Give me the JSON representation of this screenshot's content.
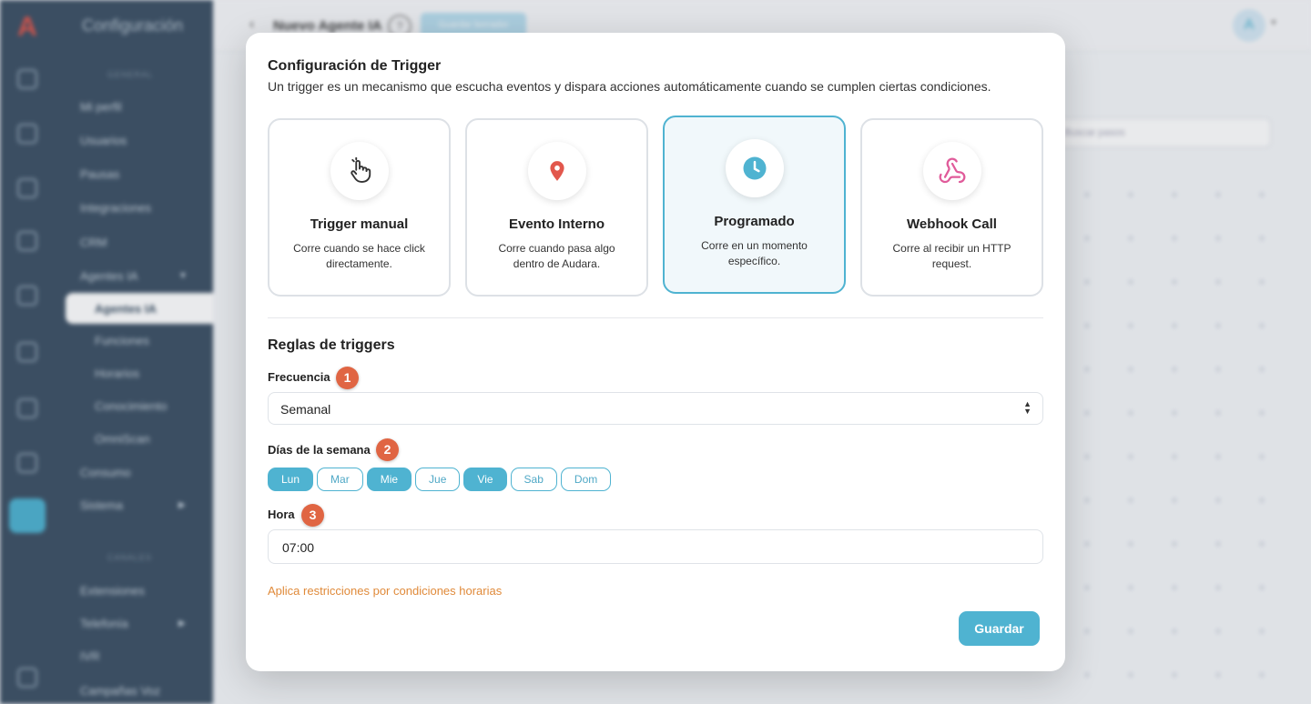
{
  "app": {
    "logo": "A",
    "menu_title": "Configuración",
    "section_general": "GENERAL",
    "section_channels": "CANALES",
    "menu_items": [
      "Mi perfil",
      "Usuarios",
      "Pausas",
      "Integraciones",
      "CRM",
      "Agentes IA",
      "Consumo",
      "Sistema",
      "Extensiones",
      "Telefonía",
      "IVR",
      "Campañas Voz"
    ],
    "submenu_selected": "Agentes IA",
    "submenu_items": [
      "Funciones",
      "Horarios",
      "Conocimiento",
      "OmniScan"
    ],
    "page_title": "Nuevo Agente IA",
    "help": "?",
    "save_draft": "Guardar borrador",
    "avatar": "A",
    "search_placeholder": "Buscar pasos"
  },
  "modal": {
    "title": "Configuración de Trigger",
    "description": "Un trigger es un mecanismo que escucha eventos y dispara acciones automáticamente cuando se cumplen ciertas condiciones.",
    "cards": [
      {
        "title": "Trigger manual",
        "desc": "Corre cuando se hace click directamente.",
        "icon": "hand-pointer-icon"
      },
      {
        "title": "Evento Interno",
        "desc": "Corre cuando pasa algo dentro de Audara.",
        "icon": "map-pin-icon"
      },
      {
        "title": "Programado",
        "desc": "Corre en un momento específico.",
        "icon": "clock-icon",
        "selected": true
      },
      {
        "title": "Webhook Call",
        "desc": "Corre al recibir un HTTP request.",
        "icon": "webhook-icon"
      }
    ],
    "rules_title": "Reglas de triggers",
    "frequency": {
      "label": "Frecuencia",
      "badge": "1",
      "value": "Semanal"
    },
    "days": {
      "label": "Días de la semana",
      "badge": "2",
      "items": [
        {
          "label": "Lun",
          "on": true
        },
        {
          "label": "Mar",
          "on": false
        },
        {
          "label": "Mie",
          "on": true
        },
        {
          "label": "Jue",
          "on": false
        },
        {
          "label": "Vie",
          "on": true
        },
        {
          "label": "Sab",
          "on": false
        },
        {
          "label": "Dom",
          "on": false
        }
      ]
    },
    "time": {
      "label": "Hora",
      "badge": "3",
      "value": "07:00"
    },
    "restrictions_link": "Aplica restricciones por condiciones horarias",
    "save_label": "Guardar"
  },
  "colors": {
    "accent": "#4fb3d1",
    "badge": "#e06543",
    "link": "#e08a3a",
    "sidebar": "#3e5266"
  }
}
